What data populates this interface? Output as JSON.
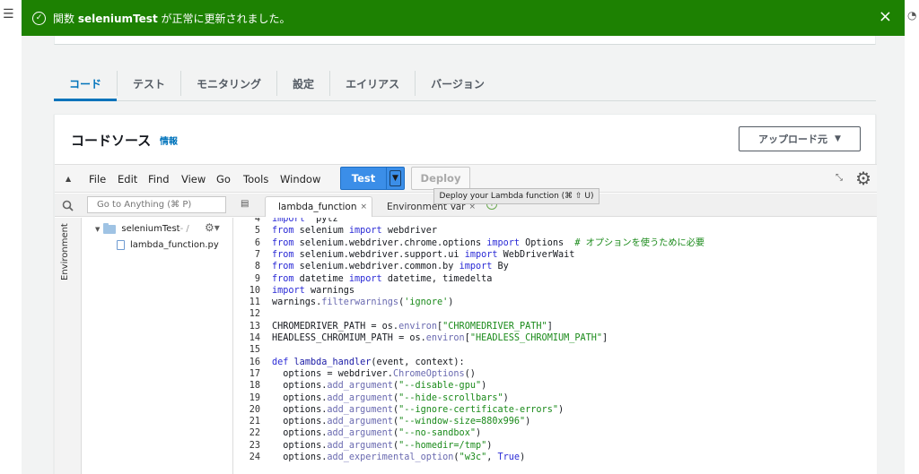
{
  "notification": {
    "message_prefix": "関数 ",
    "function_name": "seleniumTest",
    "message_suffix": " が正常に更新されました。",
    "close_label": "×",
    "background_color": "#1d8102"
  },
  "tabs": [
    "コード",
    "テスト",
    "モニタリング",
    "設定",
    "エイリアス",
    "バージョン"
  ],
  "code_source": {
    "title": "コードソース",
    "info_link": "情報",
    "upload_button": "アップロード元"
  },
  "ide": {
    "menu": [
      "File",
      "Edit",
      "Find",
      "View",
      "Go",
      "Tools",
      "Window"
    ],
    "test_button": "Test",
    "deploy_button": "Deploy",
    "deploy_tooltip": "Deploy your Lambda function (⌘ ⇧ U)",
    "goto_placeholder": "Go to Anything (⌘ P)",
    "environment_label": "Environment",
    "tree": {
      "folder": "seleniumTest",
      "folder_path": " - /",
      "file": "lambda_function.py"
    },
    "file_tabs": [
      {
        "label": "lambda_function",
        "active": true
      },
      {
        "label": "Environment Var",
        "active": false
      }
    ]
  },
  "code_lines": [
    {
      "n": "4",
      "tokens": [
        [
          "kw",
          "import"
        ],
        [
          "",
          "  pytz"
        ]
      ]
    },
    {
      "n": "5",
      "tokens": [
        [
          "kw",
          "from"
        ],
        [
          "",
          " selenium "
        ],
        [
          "kw",
          "import"
        ],
        [
          "",
          " webdriver"
        ]
      ]
    },
    {
      "n": "6",
      "tokens": [
        [
          "kw",
          "from"
        ],
        [
          "",
          " selenium.webdriver.chrome.options "
        ],
        [
          "kw",
          "import"
        ],
        [
          "",
          " Options  "
        ],
        [
          "cm",
          "# オプションを使うために必要"
        ]
      ]
    },
    {
      "n": "7",
      "tokens": [
        [
          "kw",
          "from"
        ],
        [
          "",
          " selenium.webdriver.support.ui "
        ],
        [
          "kw",
          "import"
        ],
        [
          "",
          " WebDriverWait"
        ]
      ]
    },
    {
      "n": "8",
      "tokens": [
        [
          "kw",
          "from"
        ],
        [
          "",
          " selenium.webdriver.common.by "
        ],
        [
          "kw",
          "import"
        ],
        [
          "",
          " By"
        ]
      ]
    },
    {
      "n": "9",
      "tokens": [
        [
          "kw",
          "from"
        ],
        [
          "",
          " datetime "
        ],
        [
          "kw",
          "import"
        ],
        [
          "",
          " datetime, timedelta"
        ]
      ]
    },
    {
      "n": "10",
      "tokens": [
        [
          "kw",
          "import"
        ],
        [
          "",
          " warnings"
        ]
      ]
    },
    {
      "n": "11",
      "tokens": [
        [
          "",
          "warnings."
        ],
        [
          "fn",
          "filterwarnings"
        ],
        [
          "",
          "("
        ],
        [
          "st",
          "'ignore'"
        ],
        [
          "",
          ")"
        ]
      ]
    },
    {
      "n": "12",
      "tokens": []
    },
    {
      "n": "13",
      "tokens": [
        [
          "",
          "CHROMEDRIVER_PATH = os."
        ],
        [
          "fn",
          "environ"
        ],
        [
          "",
          "["
        ],
        [
          "st",
          "\"CHROMEDRIVER_PATH\""
        ],
        [
          "",
          "]"
        ]
      ]
    },
    {
      "n": "14",
      "tokens": [
        [
          "",
          "HEADLESS_CHROMIUM_PATH = os."
        ],
        [
          "fn",
          "environ"
        ],
        [
          "",
          "["
        ],
        [
          "st",
          "\"HEADLESS_CHROMIUM_PATH\""
        ],
        [
          "",
          "]"
        ]
      ]
    },
    {
      "n": "15",
      "tokens": []
    },
    {
      "n": "16",
      "tokens": [
        [
          "kw",
          "def"
        ],
        [
          "",
          " "
        ],
        [
          "df",
          "lambda_handler"
        ],
        [
          "",
          "(event, context):"
        ]
      ]
    },
    {
      "n": "17",
      "tokens": [
        [
          "",
          "  options = webdriver."
        ],
        [
          "fn",
          "ChromeOptions"
        ],
        [
          "",
          "()"
        ]
      ]
    },
    {
      "n": "18",
      "tokens": [
        [
          "",
          "  options."
        ],
        [
          "fn",
          "add_argument"
        ],
        [
          "",
          "("
        ],
        [
          "st",
          "\"--disable-gpu\""
        ],
        [
          "",
          ")"
        ]
      ]
    },
    {
      "n": "19",
      "tokens": [
        [
          "",
          "  options."
        ],
        [
          "fn",
          "add_argument"
        ],
        [
          "",
          "("
        ],
        [
          "st",
          "\"--hide-scrollbars\""
        ],
        [
          "",
          ")"
        ]
      ]
    },
    {
      "n": "20",
      "tokens": [
        [
          "",
          "  options."
        ],
        [
          "fn",
          "add_argument"
        ],
        [
          "",
          "("
        ],
        [
          "st",
          "\"--ignore-certificate-errors\""
        ],
        [
          "",
          ")"
        ]
      ]
    },
    {
      "n": "21",
      "tokens": [
        [
          "",
          "  options."
        ],
        [
          "fn",
          "add_argument"
        ],
        [
          "",
          "("
        ],
        [
          "st",
          "\"--window-size=880x996\""
        ],
        [
          "",
          ")"
        ]
      ]
    },
    {
      "n": "22",
      "tokens": [
        [
          "",
          "  options."
        ],
        [
          "fn",
          "add_argument"
        ],
        [
          "",
          "("
        ],
        [
          "st",
          "\"--no-sandbox\""
        ],
        [
          "",
          ")"
        ]
      ]
    },
    {
      "n": "23",
      "tokens": [
        [
          "",
          "  options."
        ],
        [
          "fn",
          "add_argument"
        ],
        [
          "",
          "("
        ],
        [
          "st",
          "\"--homedir=/tmp\""
        ],
        [
          "",
          ")"
        ]
      ]
    },
    {
      "n": "24",
      "tokens": [
        [
          "",
          "  options."
        ],
        [
          "fn",
          "add_experimental_option"
        ],
        [
          "",
          "("
        ],
        [
          "st",
          "\"w3c\""
        ],
        [
          "",
          ", "
        ],
        [
          "kw",
          "True"
        ],
        [
          "",
          ")"
        ]
      ]
    }
  ]
}
